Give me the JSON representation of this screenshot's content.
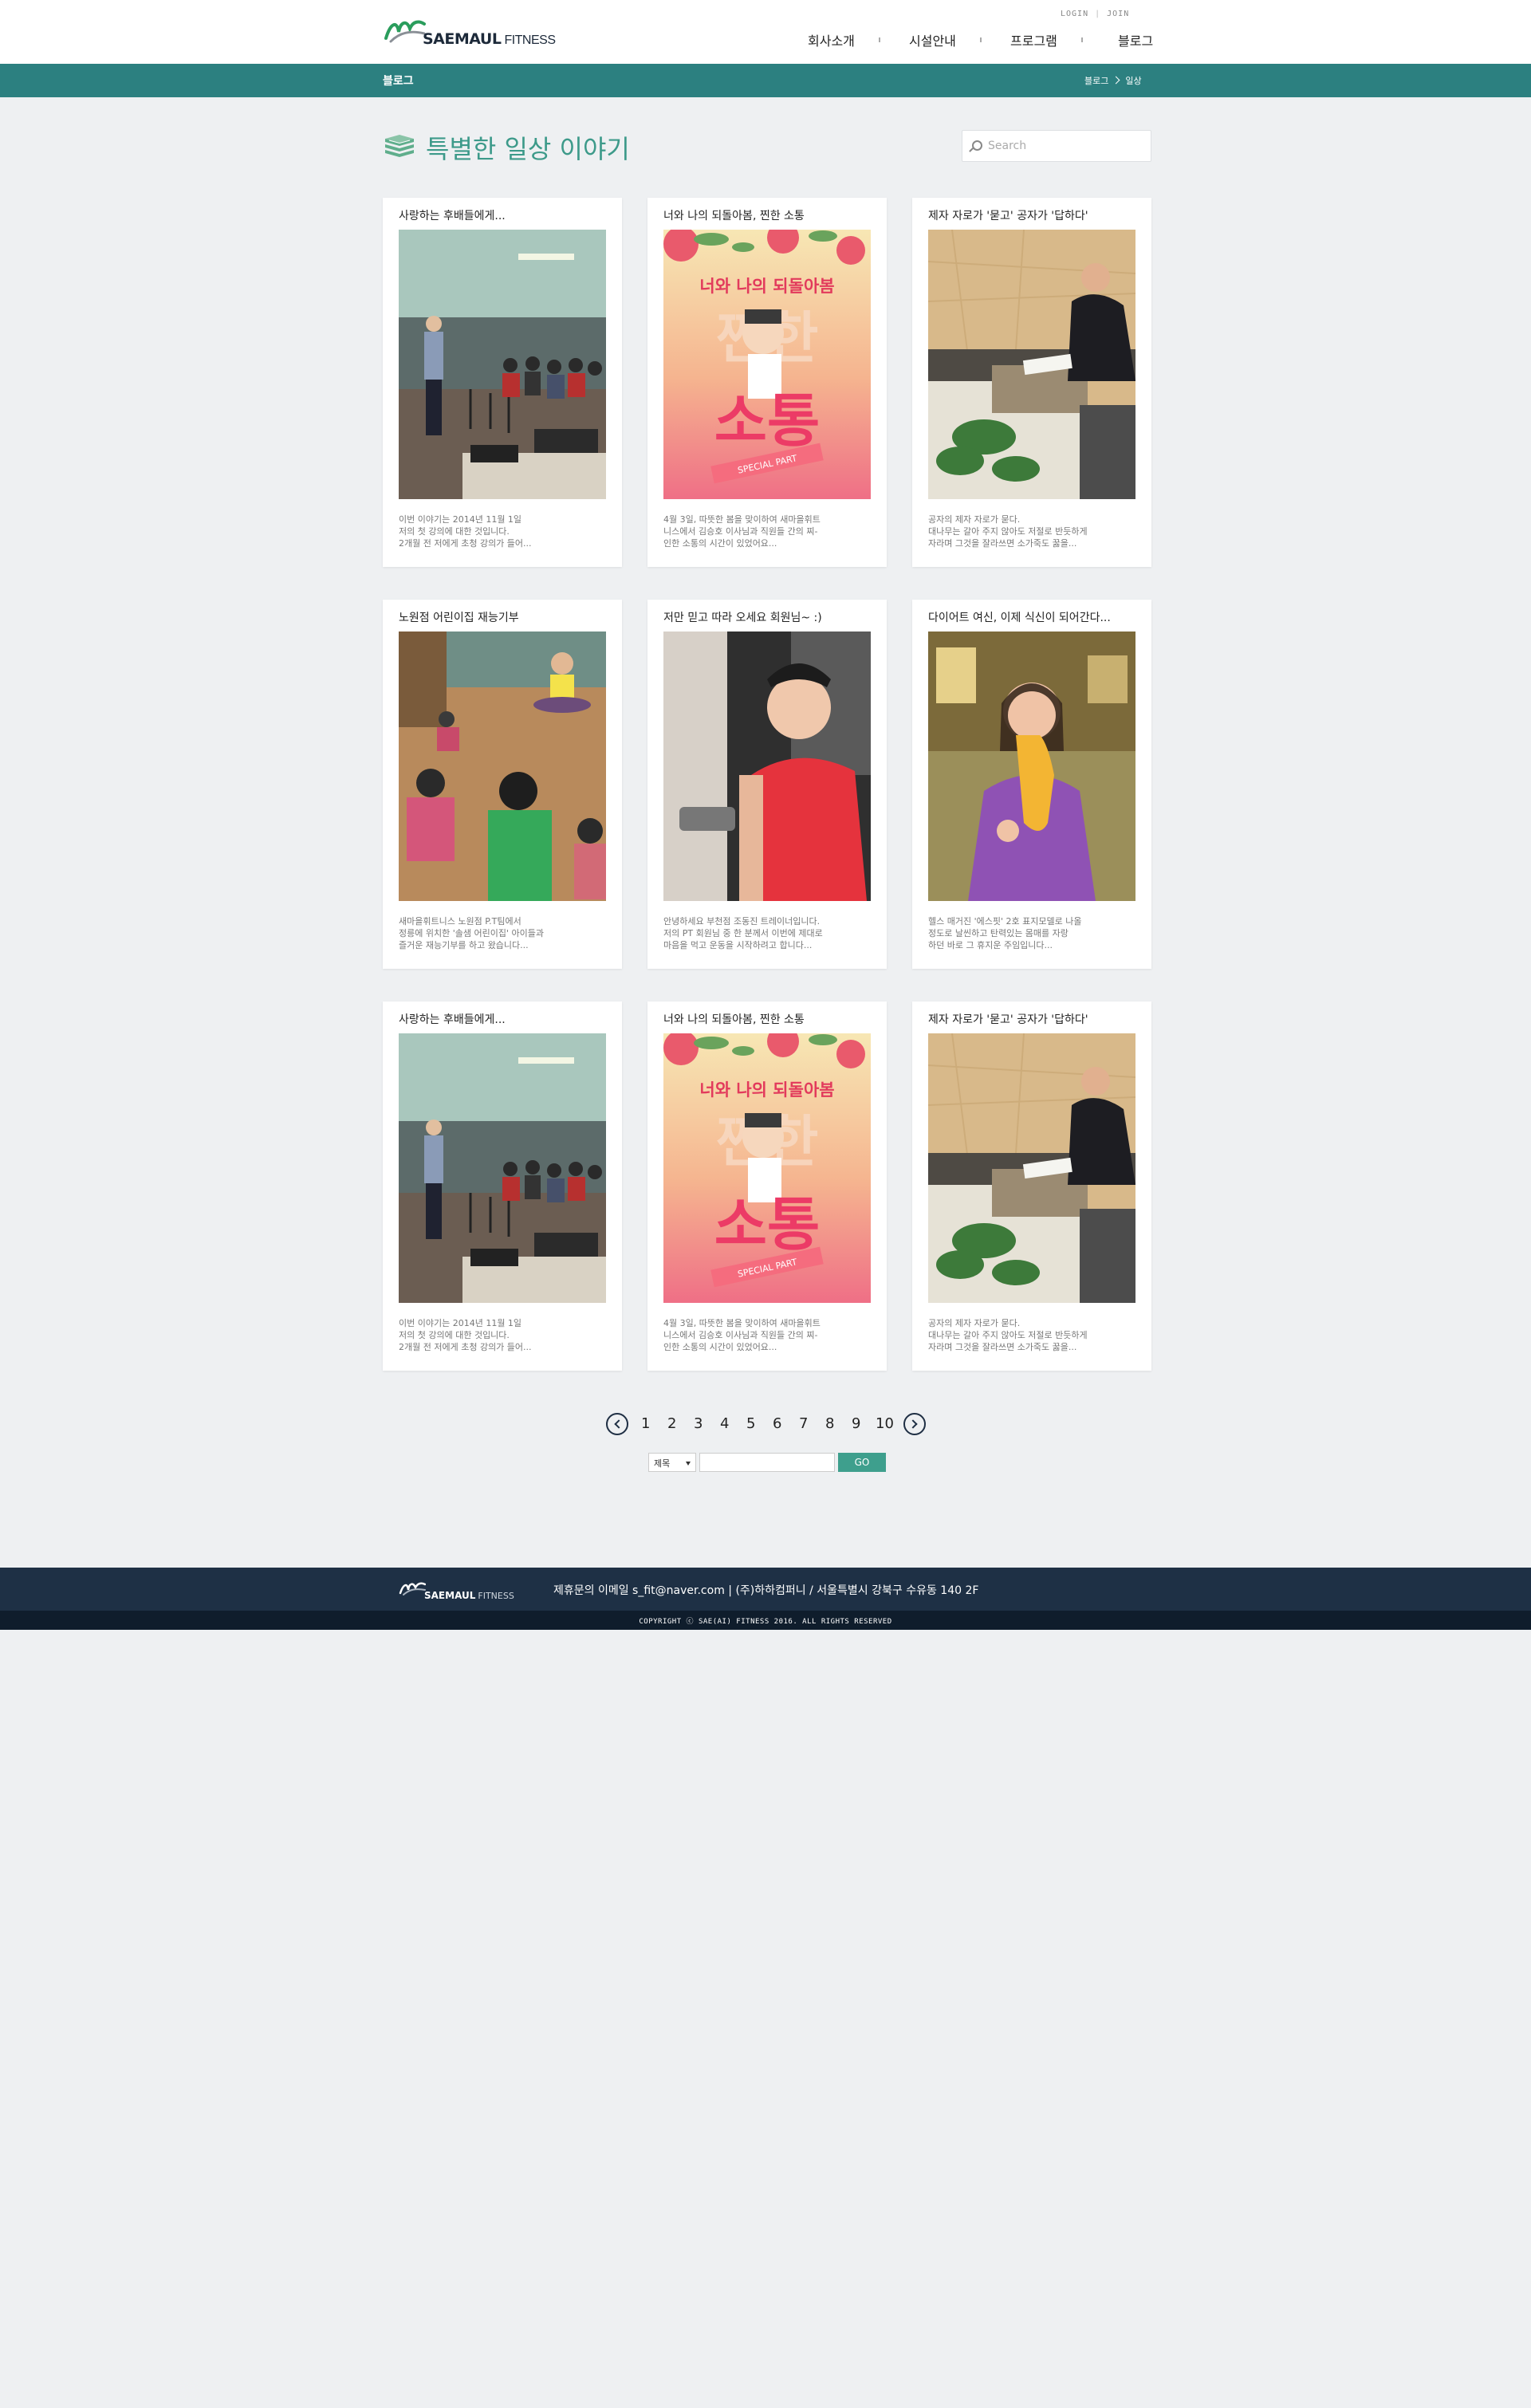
{
  "header": {
    "logo_text": "SAEMAUL",
    "logo_text2": "FITNESS",
    "login": "LOGIN",
    "join": "JOIN",
    "nav": [
      "회사소개",
      "시설안내",
      "프로그램",
      "블로그"
    ]
  },
  "subbar": {
    "section": "블로그",
    "breadcrumb": [
      "블로그",
      "일상"
    ]
  },
  "page": {
    "title": "특별한 일상 이야기",
    "search_placeholder": "Search"
  },
  "cards": [
    {
      "title": "사랑하는 후배들에게...",
      "desc": [
        "이번 이야기는 2014년 11월 1일",
        "저의 첫 강의에 대한 것입니다.",
        "2개월 전 저에게 초청 강의가 들어..."
      ],
      "image": "lecture"
    },
    {
      "title": "너와 나의 되돌아봄, 찐한 소통",
      "desc": [
        "4월 3일, 따뜻한 봄을 맞이하여 새마을휘트",
        "니스에서 김승호 이사님과 직원들 간의 찌-",
        "인한 소통의 시간이 있었어요..."
      ],
      "image": "poster",
      "poster_lines": [
        "너와 나의 되돌아봄",
        "찐한",
        "소통",
        "SPECIAL PART"
      ]
    },
    {
      "title": "제자 자로가 '묻고' 공자가 '답하다'",
      "desc": [
        "공자의 제자 자로가 묻다.",
        "대나무는 갈아 주지 않아도 저절로 반듯하게",
        "자라며 그것을 잘라쓰면 소가죽도 꿇을..."
      ],
      "image": "office"
    },
    {
      "title": "노원점 어린이집 재능기부",
      "desc": [
        "새마을휘트니스 노원점 P.T팀에서",
        "정릉에 위치한 '솔샘 어린이집' 아이들과",
        "즐거운 재능기부를 하고 왔습니다..."
      ],
      "image": "kids"
    },
    {
      "title": "저만 믿고 따라 오세요 회원님~ :)",
      "desc": [
        "안녕하세요 부천점 조동진 트레이너입니다.",
        "저의 PT 회원님 중 한 분께서 이번에 제대로",
        "마음을 먹고 운동을 시작하려고 합니다..."
      ],
      "image": "trainer"
    },
    {
      "title": "다이어트 여신, 이제 식신이 되어간다...",
      "desc": [
        "헬스 매거진 '에스핏' 2호 표지모델로 나올",
        "정도로 날씬하고 탄력있는 몸매를 자랑",
        "하던 바로 그 휴지운 주임입니다..."
      ],
      "image": "woman"
    },
    {
      "title": "사랑하는 후배들에게...",
      "desc": [
        "이번 이야기는 2014년 11월 1일",
        "저의 첫 강의에 대한 것입니다.",
        "2개월 전 저에게 초청 강의가 들어..."
      ],
      "image": "lecture"
    },
    {
      "title": "너와 나의 되돌아봄, 찐한 소통",
      "desc": [
        "4월 3일, 따뜻한 봄을 맞이하여 새마을휘트",
        "니스에서 김승호 이사님과 직원들 간의 찌-",
        "인한 소통의 시간이 있었어요..."
      ],
      "image": "poster",
      "poster_lines": [
        "너와 나의 되돌아봄",
        "찐한",
        "소통",
        "SPECIAL PART"
      ]
    },
    {
      "title": "제자 자로가 '묻고' 공자가 '답하다'",
      "desc": [
        "공자의 제자 자로가 묻다.",
        "대나무는 갈아 주지 않아도 저절로 반듯하게",
        "자라며 그것을 잘라쓰면 소가죽도 꿇을..."
      ],
      "image": "office"
    }
  ],
  "pagination": {
    "pages": [
      "1",
      "2",
      "3",
      "4",
      "5",
      "6",
      "7",
      "8",
      "9",
      "10"
    ]
  },
  "board_search": {
    "select_value": "제목",
    "go_label": "GO"
  },
  "footer": {
    "logo_text": "SAEMAUL",
    "logo_text2": "FITNESS",
    "info": "제휴문의 이메일 s_fit@naver.com  |  (주)하하컴퍼니 / 서울특별시 강북구 수유동 140 2F",
    "copyright": "COPYRIGHT ⓒ SAE(AI) FITNESS 2016. ALL RIGHTS RESERVED"
  },
  "colors": {
    "accent": "#2c8080",
    "title": "#3d9a8a",
    "footer": "#1e3045"
  }
}
